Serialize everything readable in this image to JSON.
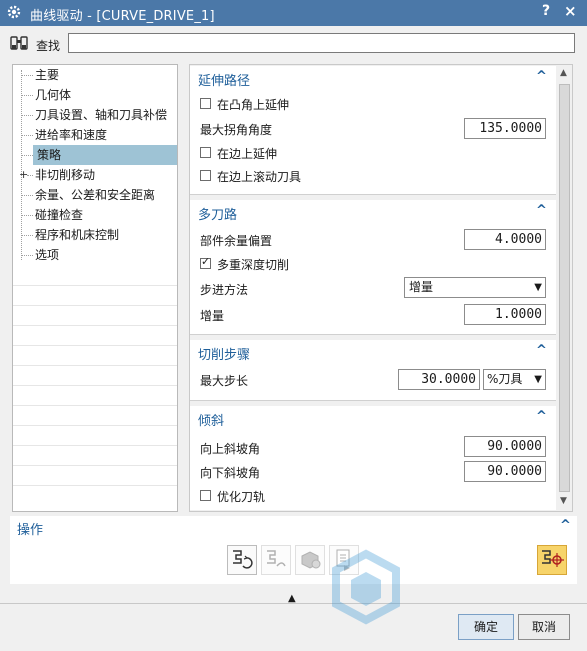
{
  "window": {
    "title": "曲线驱动 - [CURVE_DRIVE_1]",
    "help": "?",
    "close": "×"
  },
  "search": {
    "label": "查找",
    "value": ""
  },
  "tree": {
    "items": [
      {
        "label": "主要"
      },
      {
        "label": "几何体"
      },
      {
        "label": "刀具设置、轴和刀具补偿"
      },
      {
        "label": "进给率和速度"
      },
      {
        "label": "策略",
        "selected": true
      },
      {
        "label": "非切削移动",
        "expandable": true
      },
      {
        "label": "余量、公差和安全距离"
      },
      {
        "label": "碰撞检查"
      },
      {
        "label": "程序和机床控制"
      },
      {
        "label": "选项"
      }
    ]
  },
  "sections": {
    "extend": {
      "title": "延伸路径",
      "extend_on_convex": "在凸角上延伸",
      "max_corner_angle_label": "最大拐角角度",
      "max_corner_angle": "135.0000",
      "extend_at_edges": "在边上延伸",
      "roll_tool_over_edges": "在边上滚动刀具"
    },
    "multipass": {
      "title": "多刀路",
      "part_stock_offset_label": "部件余量偏置",
      "part_stock_offset": "4.0000",
      "multiple_depth_cuts": "多重深度切削",
      "step_method_label": "步进方法",
      "step_method": "增量",
      "increment_label": "增量",
      "increment": "1.0000"
    },
    "stepover": {
      "title": "切削步骤",
      "max_step_label": "最大步长",
      "max_step": "30.0000",
      "max_step_unit": "%刀具"
    },
    "tilt": {
      "title": "倾斜",
      "ramp_up_label": "向上斜坡角",
      "ramp_up": "90.0000",
      "ramp_down_label": "向下斜坡角",
      "ramp_down": "90.0000",
      "optimize_path": "优化刀轨"
    }
  },
  "operations": {
    "title": "操作"
  },
  "buttons": {
    "ok": "确定",
    "cancel": "取消"
  },
  "colors": {
    "titlebar": "#4b78a8",
    "accent": "#1f5f9a",
    "selected": "#9ec3d5"
  }
}
